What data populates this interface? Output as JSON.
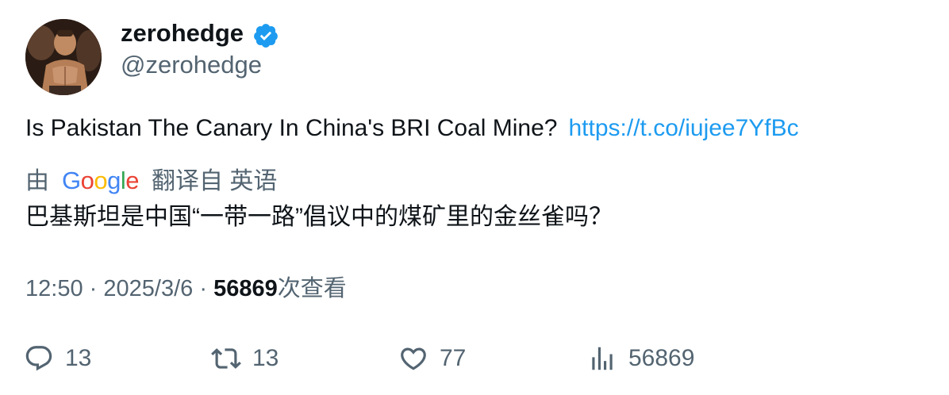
{
  "user": {
    "display_name": "zerohedge",
    "handle": "@zerohedge",
    "verified": true
  },
  "tweet": {
    "text": "Is Pakistan The Canary In China's BRI Coal Mine?",
    "link": "https://t.co/iujee7YfBc"
  },
  "translation": {
    "prefix": "由",
    "provider": "Google",
    "suffix": "翻译自 英语",
    "text": "巴基斯坦是中国“一带一路”倡议中的煤矿里的金丝雀吗？"
  },
  "meta": {
    "time": "12:50",
    "separator": "·",
    "date": "2025/3/6",
    "views_count": "56869",
    "views_label": "次查看"
  },
  "actions": {
    "replies": "13",
    "retweets": "13",
    "likes": "77",
    "views": "56869"
  },
  "colors": {
    "link": "#1d9bf0",
    "verified": "#1d9bf0",
    "secondary_text": "#536471",
    "primary_text": "#0f1419"
  }
}
